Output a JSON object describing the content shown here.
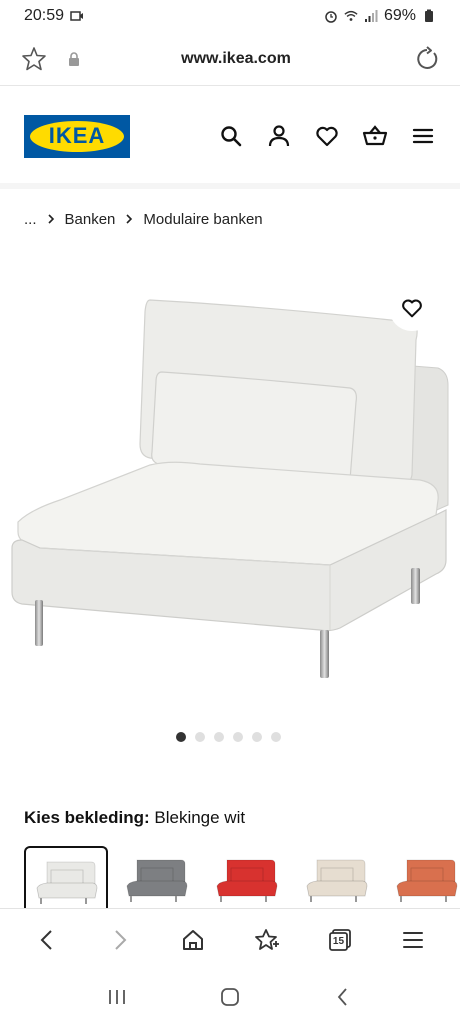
{
  "status_bar": {
    "time": "20:59",
    "battery": "69%"
  },
  "browser": {
    "url": "www.ikea.com",
    "tabs_count": "15"
  },
  "header": {
    "logo_text": "IKEA",
    "icons": [
      "search-icon",
      "account-icon",
      "heart-icon",
      "basket-icon",
      "menu-icon"
    ]
  },
  "breadcrumb": {
    "ellipsis": "...",
    "items": [
      "Banken",
      "Modulaire banken"
    ]
  },
  "carousel": {
    "total": 6,
    "active_index": 0
  },
  "cover": {
    "label": "Kies bekleding:",
    "value": "Blekinge wit",
    "swatches": [
      {
        "name": "Blekinge wit",
        "color": "#e9e9e6",
        "selected": true
      },
      {
        "name": "grijs",
        "color": "#7d7f82",
        "selected": false
      },
      {
        "name": "rood",
        "color": "#d8322f",
        "selected": false
      },
      {
        "name": "beige",
        "color": "#e6ddd0",
        "selected": false
      },
      {
        "name": "oranje",
        "color": "#d9704e",
        "selected": false
      }
    ]
  },
  "colors": {
    "ikea_blue": "#0058a3",
    "ikea_yellow": "#ffdb00"
  }
}
